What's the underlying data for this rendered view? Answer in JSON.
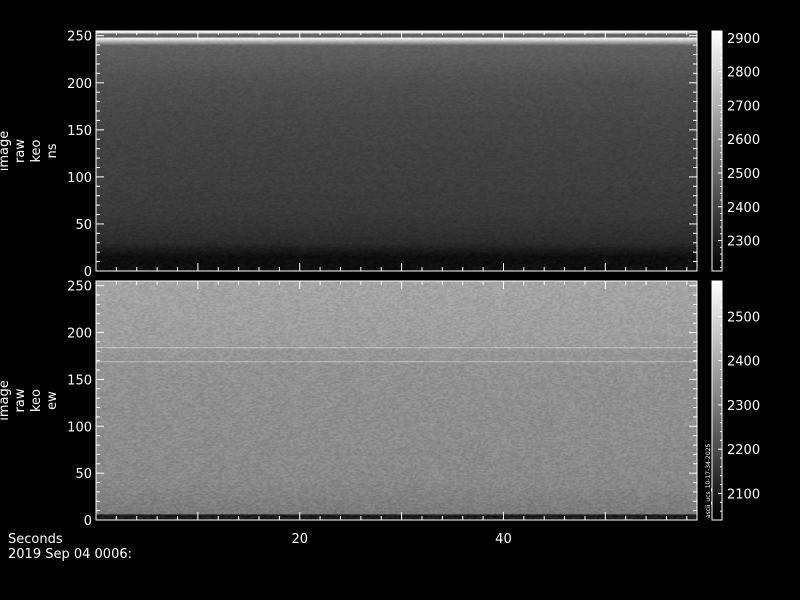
{
  "chart_data": [
    {
      "type": "heatmap",
      "ylabel": [
        "image",
        "raw",
        "keo",
        "ns"
      ],
      "xlim": [
        0,
        59
      ],
      "ylim": [
        0,
        255
      ],
      "ytick_labels": [
        "0",
        "50",
        "100",
        "150",
        "200",
        "250"
      ],
      "yticks": [
        0,
        50,
        100,
        150,
        200,
        250
      ],
      "colorbar": {
        "range": [
          2210,
          2920
        ],
        "ticks": [
          2300,
          2400,
          2500,
          2600,
          2700,
          2800,
          2900
        ],
        "tick_labels": [
          "2300",
          "2400",
          "2500",
          "2600",
          "2700",
          "2800",
          "2900"
        ]
      },
      "profile": [
        [
          0,
          2250
        ],
        [
          15,
          2250
        ],
        [
          30,
          2330
        ],
        [
          60,
          2370
        ],
        [
          100,
          2385
        ],
        [
          150,
          2400
        ],
        [
          200,
          2430
        ],
        [
          240,
          2480
        ],
        [
          248,
          2900
        ],
        [
          249,
          2480
        ],
        [
          252,
          2490
        ],
        [
          254,
          2880
        ],
        [
          255,
          2880
        ]
      ]
    },
    {
      "type": "heatmap",
      "ylabel": [
        "image",
        "raw",
        "keo",
        "ew"
      ],
      "xlim": [
        0,
        59
      ],
      "ylim": [
        0,
        255
      ],
      "ytick_labels": [
        "0",
        "50",
        "100",
        "150",
        "200",
        "250"
      ],
      "yticks": [
        0,
        50,
        100,
        150,
        200,
        250
      ],
      "colorbar": {
        "range": [
          2040,
          2580
        ],
        "ticks": [
          2100,
          2200,
          2300,
          2400,
          2500
        ],
        "tick_labels": [
          "2100",
          "2200",
          "2300",
          "2400",
          "2500"
        ]
      },
      "profile": [
        [
          0,
          2100
        ],
        [
          5,
          2100
        ],
        [
          6,
          2300
        ],
        [
          40,
          2330
        ],
        [
          100,
          2340
        ],
        [
          160,
          2350
        ],
        [
          168,
          2350
        ],
        [
          169,
          2450
        ],
        [
          170,
          2355
        ],
        [
          183,
          2360
        ],
        [
          184,
          2460
        ],
        [
          185,
          2370
        ],
        [
          220,
          2380
        ],
        [
          255,
          2390
        ]
      ],
      "annotation": "ascii_ucs_10-17-34-2025"
    }
  ],
  "x_axis": {
    "label": "Seconds",
    "date": "2019 Sep 04 0006:",
    "ticks": [
      20,
      40
    ],
    "tick_labels": [
      "20",
      "40"
    ]
  }
}
